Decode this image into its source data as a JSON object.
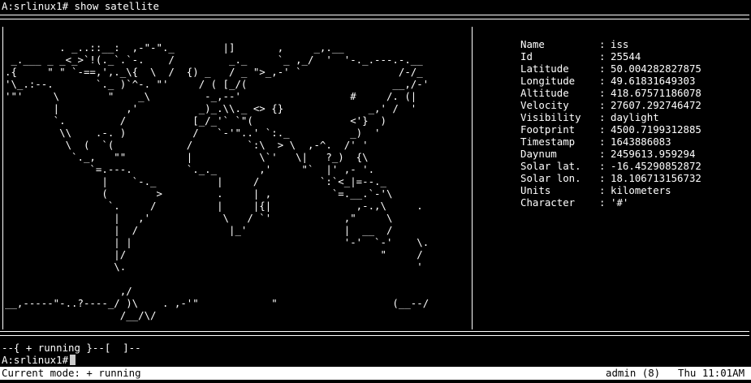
{
  "terminal": {
    "prompt_command": "A:srlinux1# show satellite",
    "prompt_final": "A:srlinux1#",
    "running_line": "--{ + running }--[  ]--"
  },
  "map": {
    "ascii": "\n         . _..::__:  ,-\"-\"._        |]       ,     _,.__\n _.___ _ _<_>`!(._`.`-.    /         _._     `_ ,_/  '  '-._.---.-.__\n.{     \" \" `-==,',._\\{  \\  /  {) _   / _ \">_,-' `                /-/_\n'\\_.:--.       `._ )`^-. \"'     / ( [_/(                        __,/-'\n'\"'     \\        \"    _\\         -_,--'                  #     /. (|\n        |           ,'          _)_.\\\\._ <> {}              _,' /  '\n        `.         /           [_/_'` `\"(                <'}  )\n         \\\\    .-. )           /   `-'\"..' `:._          _)  '\n          \\  (  `(            /         `:\\  > \\  ,-^.  /' '\n           `._,   \"\"          |           \\`'   \\|   ?_)  {\\\n              `=.---.         `._._       ,'     \"`  |' ,- '.\n                |    `-._          |     /          `:`<_|=--._\n                (        >         .     | ,          `=.__.`-'\\\n                 `.     /          |     |{|              ,-.,\\     .\n                  |   ,'            \\   / `'            ,\"     \\\n                  |  /               |_'                |  __  /\n                  | |                                   '-'  `-'    \\.\n                  |/                                          \"     /\n                  \\.                                                '\n\n                   ,/\n__,-----\"-..?----_/ )\\    . ,-'\"            \"                   (__--/\n                   /__/\\/"
  },
  "info": {
    "rows": [
      {
        "key": "Name",
        "value": "iss"
      },
      {
        "key": "Id",
        "value": "25544"
      },
      {
        "key": "Latitude",
        "value": "50.004282827875"
      },
      {
        "key": "Longitude",
        "value": "49.61831649303"
      },
      {
        "key": "Altitude",
        "value": "418.67571186078"
      },
      {
        "key": "Velocity",
        "value": "27607.292746472"
      },
      {
        "key": "Visibility",
        "value": "daylight"
      },
      {
        "key": "Footprint",
        "value": "4500.7199312885"
      },
      {
        "key": "Timestamp",
        "value": "1643886083"
      },
      {
        "key": "Daynum",
        "value": "2459613.959294"
      },
      {
        "key": "Solar lat.",
        "value": "-16.45290852872"
      },
      {
        "key": "Solar lon.",
        "value": "18.106713156732"
      },
      {
        "key": "Units",
        "value": "kilometers"
      },
      {
        "key": "Character",
        "value": "'#'"
      }
    ]
  },
  "status_bar": {
    "mode": "Current mode: + running",
    "user": "admin (8)",
    "time": "Thu 11:01AM"
  }
}
